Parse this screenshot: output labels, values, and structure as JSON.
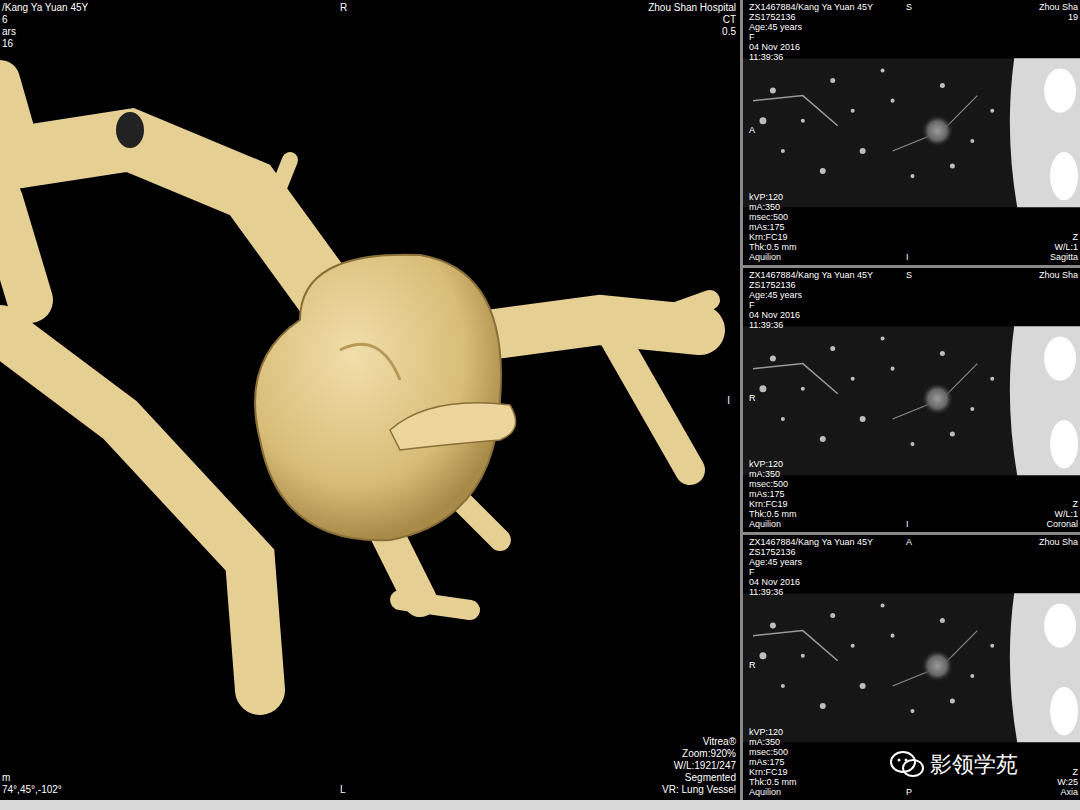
{
  "main_view": {
    "top_left": [
      "/Kang Ya Yuan 45Y",
      "6",
      "ars",
      "16"
    ],
    "top_center": "R",
    "top_right": [
      "Zhou Shan Hospital",
      "CT",
      "0.5"
    ],
    "right_mark": "I",
    "bottom_left": [
      "m",
      "74°,45°,-102°"
    ],
    "bottom_center": "L",
    "bottom_right": [
      "Vitrea®",
      "Zoom:920%",
      "W/L:1921/247",
      "Segmented",
      "VR: Lung Vessel"
    ],
    "watermark": "影领学苑"
  },
  "slices": [
    {
      "view": "sagittal",
      "header": [
        "ZX1467884/Kang Ya Yuan 45Y",
        "ZS1752136",
        "Age:45 years",
        "F",
        "04 Nov 2016",
        "11:39:36"
      ],
      "top_mark": "S",
      "left_mark": "A",
      "bottom_mark": "I",
      "top_right": [
        "Zhou Sha",
        "19"
      ],
      "params": [
        "kVP:120",
        "mA:350",
        "msec:500",
        "mAs:175",
        "Krn:FC19",
        "Thk:0.5 mm",
        "Aquilion"
      ],
      "bottom_right": [
        "Z",
        "W/L:1",
        "Sagitta"
      ]
    },
    {
      "view": "coronal",
      "header": [
        "ZX1467884/Kang Ya Yuan 45Y",
        "ZS1752136",
        "Age:45 years",
        "F",
        "04 Nov 2016",
        "11:39:36"
      ],
      "top_mark": "S",
      "left_mark": "R",
      "bottom_mark": "I",
      "top_right": [
        "Zhou Sha"
      ],
      "params": [
        "kVP:120",
        "mA:350",
        "msec:500",
        "mAs:175",
        "Krn:FC19",
        "Thk:0.5 mm",
        "Aquilion"
      ],
      "bottom_right": [
        "Z",
        "W/L:1",
        "Coronal"
      ]
    },
    {
      "view": "axial",
      "header": [
        "ZX1467884/Kang Ya Yuan 45Y",
        "ZS1752136",
        "Age:45 years",
        "F",
        "04 Nov 2016",
        "11:39:36"
      ],
      "top_mark": "A",
      "left_mark": "R",
      "bottom_mark": "P",
      "top_right": [
        "Zhou Sha"
      ],
      "params": [
        "kVP:120",
        "mA:350",
        "msec:500",
        "mAs:175",
        "Krn:FC19",
        "Thk:0.5 mm",
        "Aquilion"
      ],
      "bottom_right": [
        "Z",
        "W:25",
        "Axia"
      ]
    }
  ]
}
